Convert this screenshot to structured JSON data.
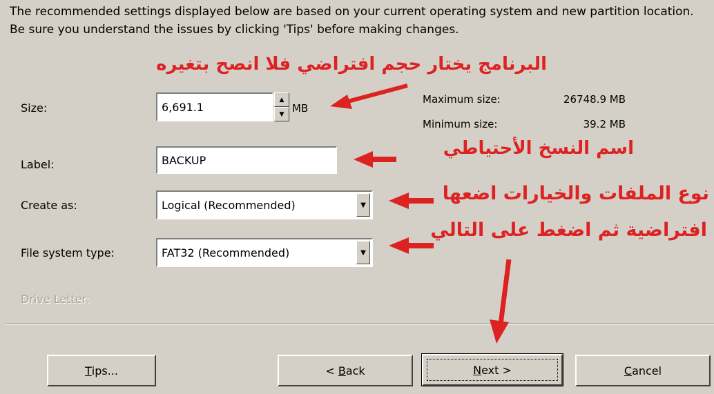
{
  "intro_text": "The recommended settings displayed below are based on your current operating system and new partition location. Be sure you understand the issues by clicking 'Tips' before making changes.",
  "size": {
    "label": "Size:",
    "value": "6,691.1",
    "unit": "MB"
  },
  "limits": {
    "max_label": "Maximum size:",
    "max_value": "26748.9 MB",
    "min_label": "Minimum size:",
    "min_value": "39.2 MB"
  },
  "label_field": {
    "label": "Label:",
    "value": "BACKUP"
  },
  "create_as": {
    "label": "Create as:",
    "value": "Logical (Recommended)"
  },
  "fs_type": {
    "label": "File system type:",
    "value": "FAT32 (Recommended)"
  },
  "drive_letter": {
    "label": "Drive Letter:"
  },
  "buttons": {
    "tips_prefix": "",
    "tips_u": "T",
    "tips_rest": "ips...",
    "back_prefix": "< ",
    "back_u": "B",
    "back_rest": "ack",
    "next_prefix": "",
    "next_u": "N",
    "next_rest": "ext >",
    "cancel_prefix": "",
    "cancel_u": "C",
    "cancel_rest": "ancel"
  },
  "annotations": {
    "size_note": "البرنامج يختار حجم افتراضي فلا انصح بتغيره",
    "label_note": "اسم النسخ الأحتياطي",
    "type_note_1": "نوع الملفات والخيارات اضعها",
    "type_note_2": "افتراضية ثم اضغط على التالي"
  },
  "colors": {
    "annotation": "#dd2222",
    "window_bg": "#d4d0c8"
  },
  "icons": {
    "spin_up": "▲",
    "spin_down": "▼",
    "dropdown": "▼"
  }
}
